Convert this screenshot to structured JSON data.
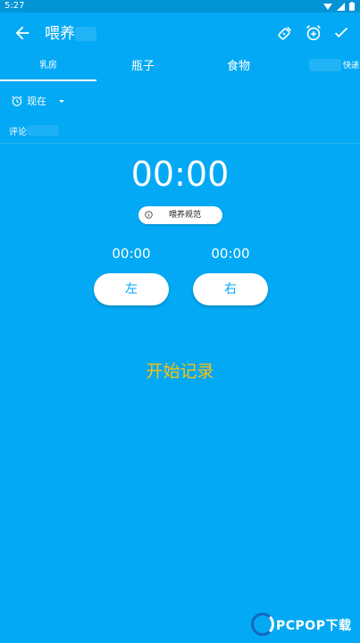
{
  "status_bar": {
    "time": "5:27"
  },
  "app_bar": {
    "title": "喂养"
  },
  "tabs": [
    {
      "label": "乳房",
      "active": true
    },
    {
      "label": "瓶子",
      "active": false
    },
    {
      "label": "食物",
      "active": false
    },
    {
      "label": "快递",
      "active": false
    }
  ],
  "time_selector": {
    "label": "现在"
  },
  "comment": {
    "label": "评论"
  },
  "timer": {
    "display": "00:00"
  },
  "guide_button": {
    "label": "喂养规范"
  },
  "left_side": {
    "time": "00:00",
    "button_label": "左"
  },
  "right_side": {
    "time": "00:00",
    "button_label": "右"
  },
  "start_button": {
    "label": "开始记录"
  },
  "watermark": {
    "text": "PCPOP下载"
  },
  "colors": {
    "background": "#03A9F4",
    "start_text": "#FFC107",
    "button_bg": "#FFFFFF"
  }
}
